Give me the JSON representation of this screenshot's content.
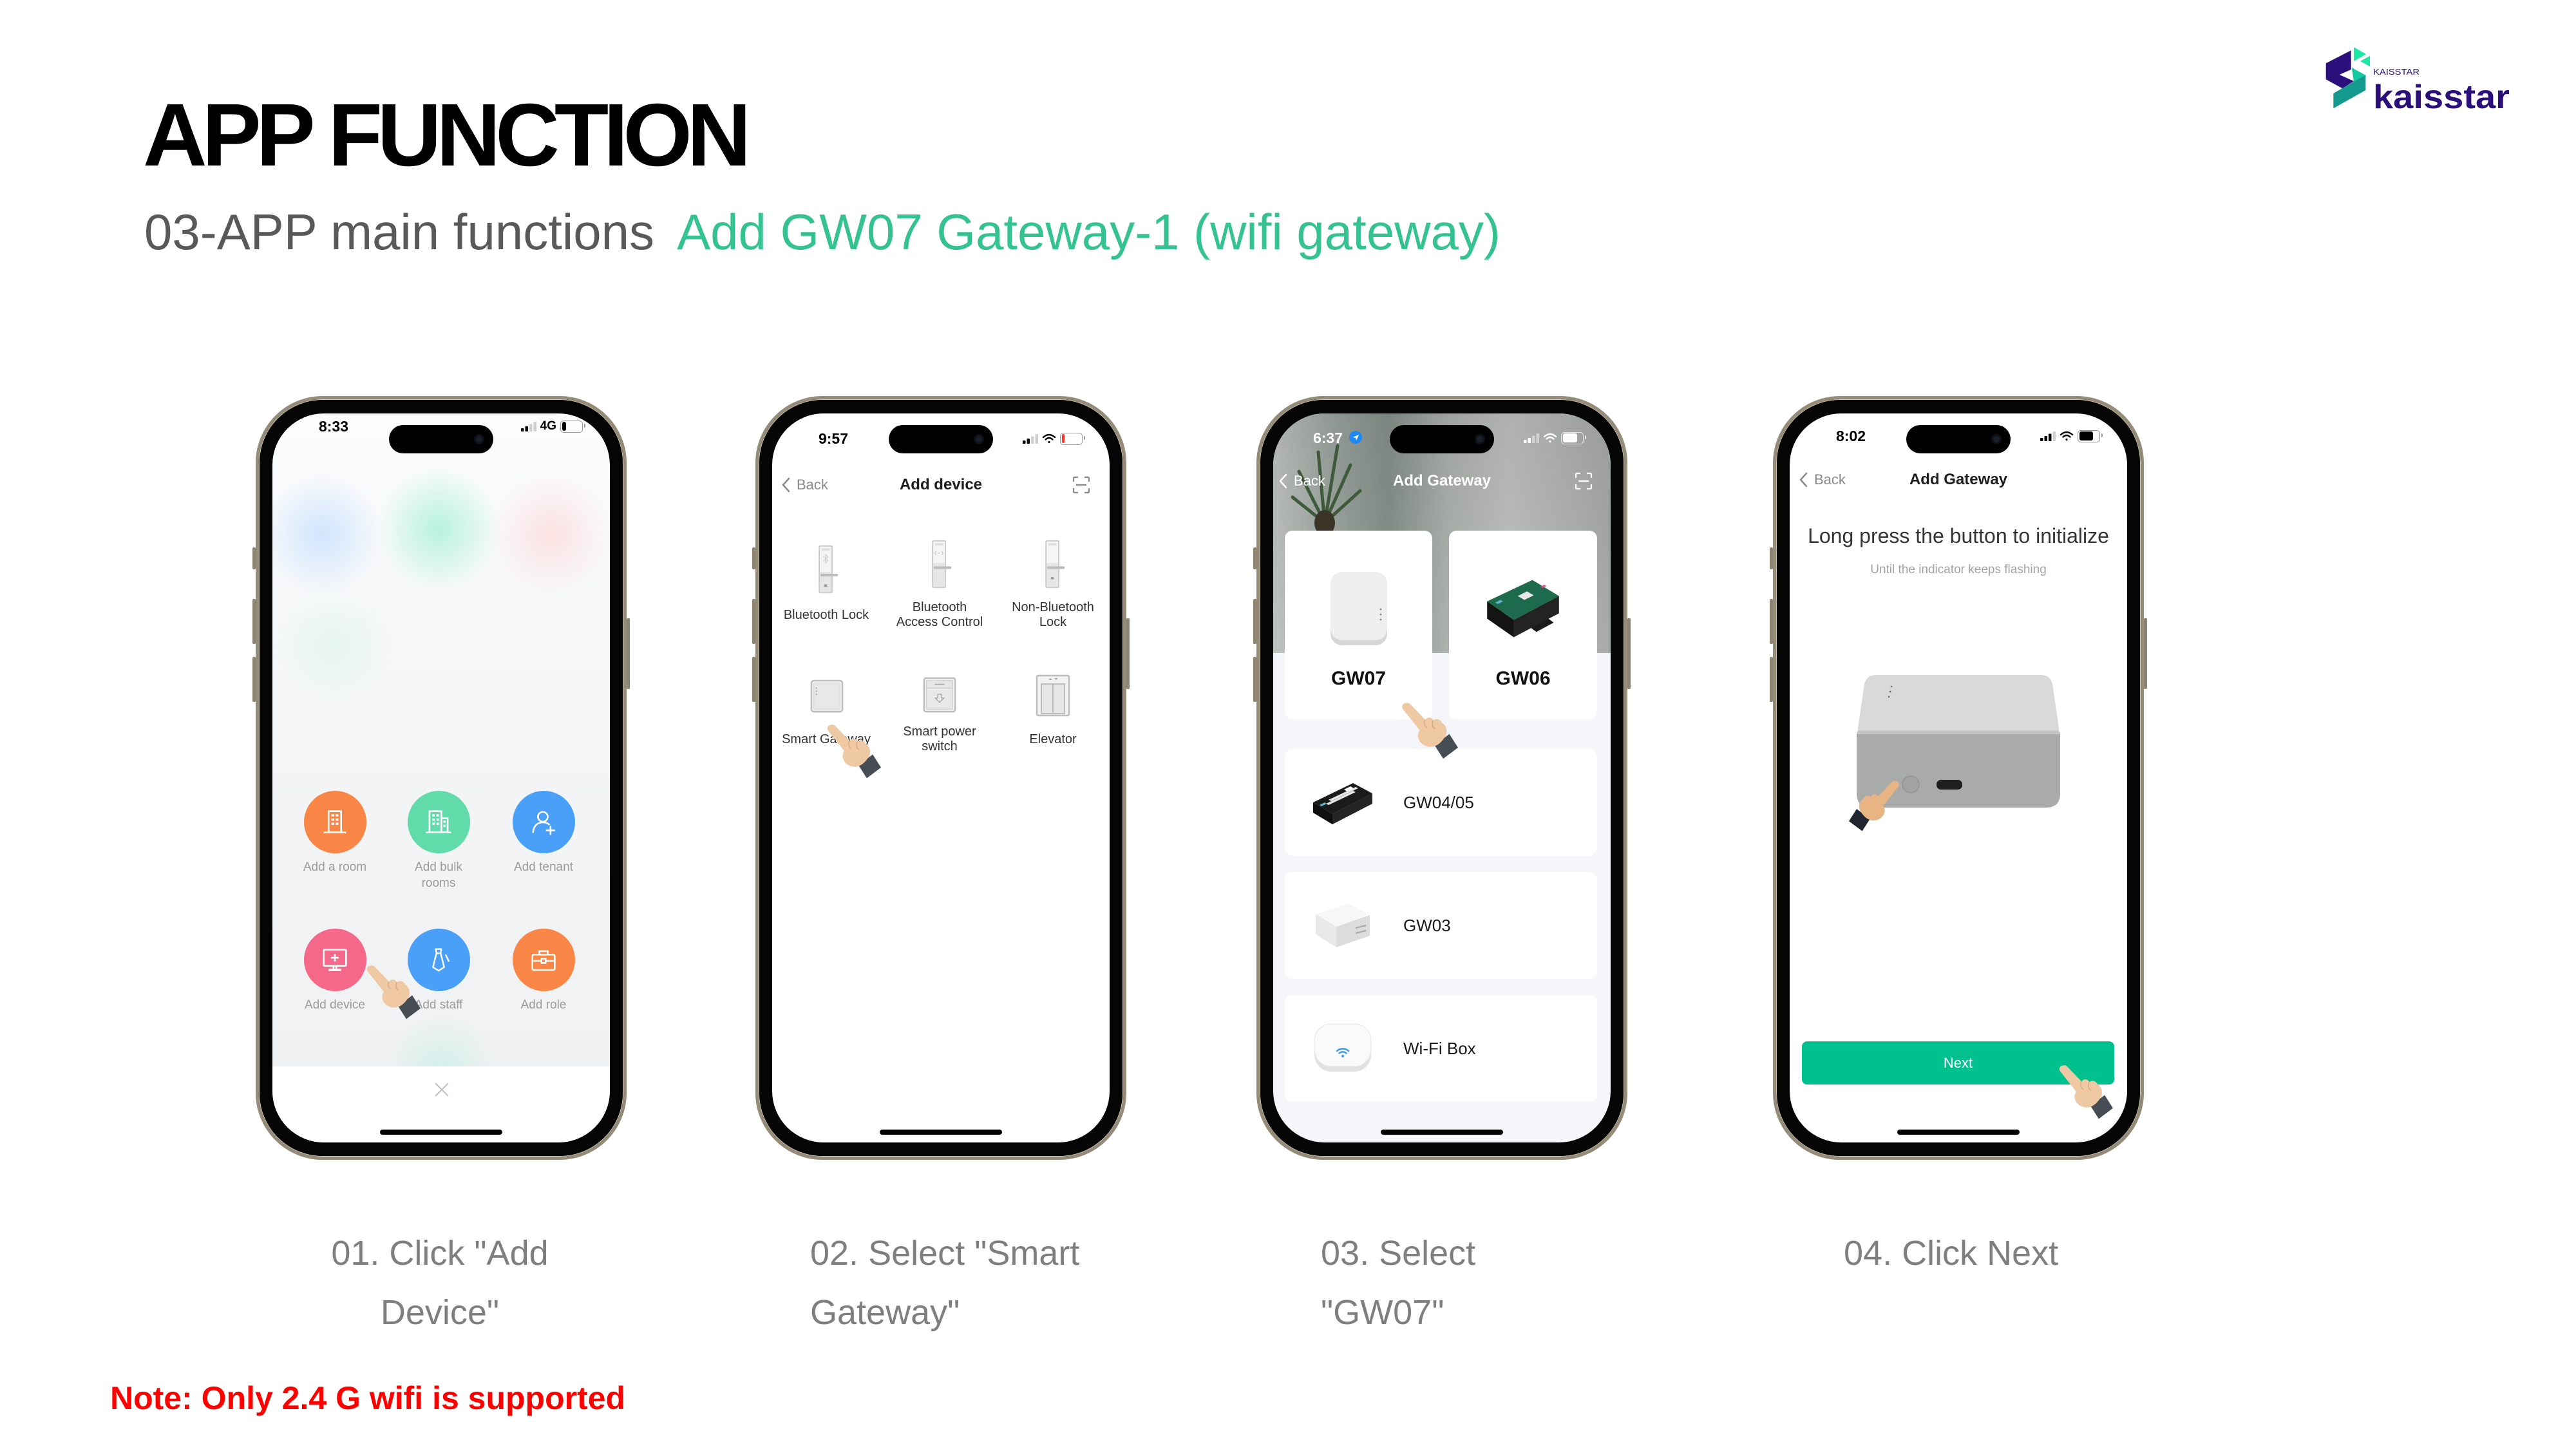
{
  "brand": {
    "tagline": "KAISSTAR",
    "wordmark": "kaisstar",
    "colors": {
      "primary": "#2b0f7a",
      "teal": "#14998f",
      "mint": "#1de9a6",
      "green": "#12c9a0"
    }
  },
  "header": {
    "title": "APP FUNCTION",
    "subtitle": "03-APP main functions",
    "highlight": "Add GW07 Gateway-1 (wifi gateway)",
    "highlight_color": "#33c290"
  },
  "steps": [
    {
      "caption": "01. Click \"Add Device\""
    },
    {
      "caption": "02. Select \"Smart Gateway\""
    },
    {
      "caption": "03. Select \"GW07\""
    },
    {
      "caption": "04. Click Next"
    }
  ],
  "note": {
    "text": "Note: Only 2.4 G wifi is supported",
    "color": "#ff0000"
  },
  "phones": [
    {
      "status": {
        "time": "8:33",
        "network": "4G",
        "signal_bars": 2,
        "signal_max": 4,
        "battery_percent": 20
      },
      "actions": [
        {
          "label": "Add a room",
          "icon": "building-icon",
          "color": "#f98546"
        },
        {
          "label": "Add bulk rooms",
          "icon": "buildings-icon",
          "color": "#62dbab"
        },
        {
          "label": "Add tenant",
          "icon": "add-user-icon",
          "color": "#4a9ff8"
        },
        {
          "label": "Add device",
          "icon": "add-device-icon",
          "color": "#f6688a"
        },
        {
          "label": "Add staff",
          "icon": "tie-icon",
          "color": "#4a9ff8"
        },
        {
          "label": "Add role",
          "icon": "briefcase-icon",
          "color": "#f98546"
        }
      ],
      "close_icon": "close-icon"
    },
    {
      "status": {
        "time": "9:57",
        "signal_bars": 2,
        "signal_max": 4,
        "battery_percent": 15
      },
      "nav": {
        "back": "Back",
        "title": "Add device",
        "scan_icon": "scan-icon"
      },
      "devices": [
        {
          "label": "Bluetooth Lock",
          "icon": "bluetooth-lock-icon"
        },
        {
          "label": "Bluetooth Access Control",
          "icon": "access-control-icon"
        },
        {
          "label": "Non-Bluetooth Lock",
          "icon": "lock-icon"
        },
        {
          "label": "Smart Gateway",
          "icon": "gateway-icon"
        },
        {
          "label": "Smart power switch",
          "icon": "power-switch-icon"
        },
        {
          "label": "Elevator",
          "icon": "elevator-icon"
        }
      ]
    },
    {
      "status": {
        "time": "6:37",
        "signal_bars": 2,
        "signal_max": 4,
        "battery_percent": 75
      },
      "nav": {
        "back": "Back",
        "title": "Add Gateway",
        "scan_icon": "scan-icon"
      },
      "featured": [
        {
          "label": "GW07"
        },
        {
          "label": "GW06"
        }
      ],
      "list": [
        {
          "label": "GW04/05"
        },
        {
          "label": "GW03"
        },
        {
          "label": "Wi-Fi Box"
        }
      ]
    },
    {
      "status": {
        "time": "8:02",
        "signal_bars": 3,
        "signal_max": 4,
        "battery_percent": 70
      },
      "nav": {
        "back": "Back",
        "title": "Add Gateway"
      },
      "instruction": "Long press the button to initialize",
      "hint": "Until the indicator keeps flashing",
      "next_button": "Next",
      "accent_color": "#00c08e"
    }
  ]
}
